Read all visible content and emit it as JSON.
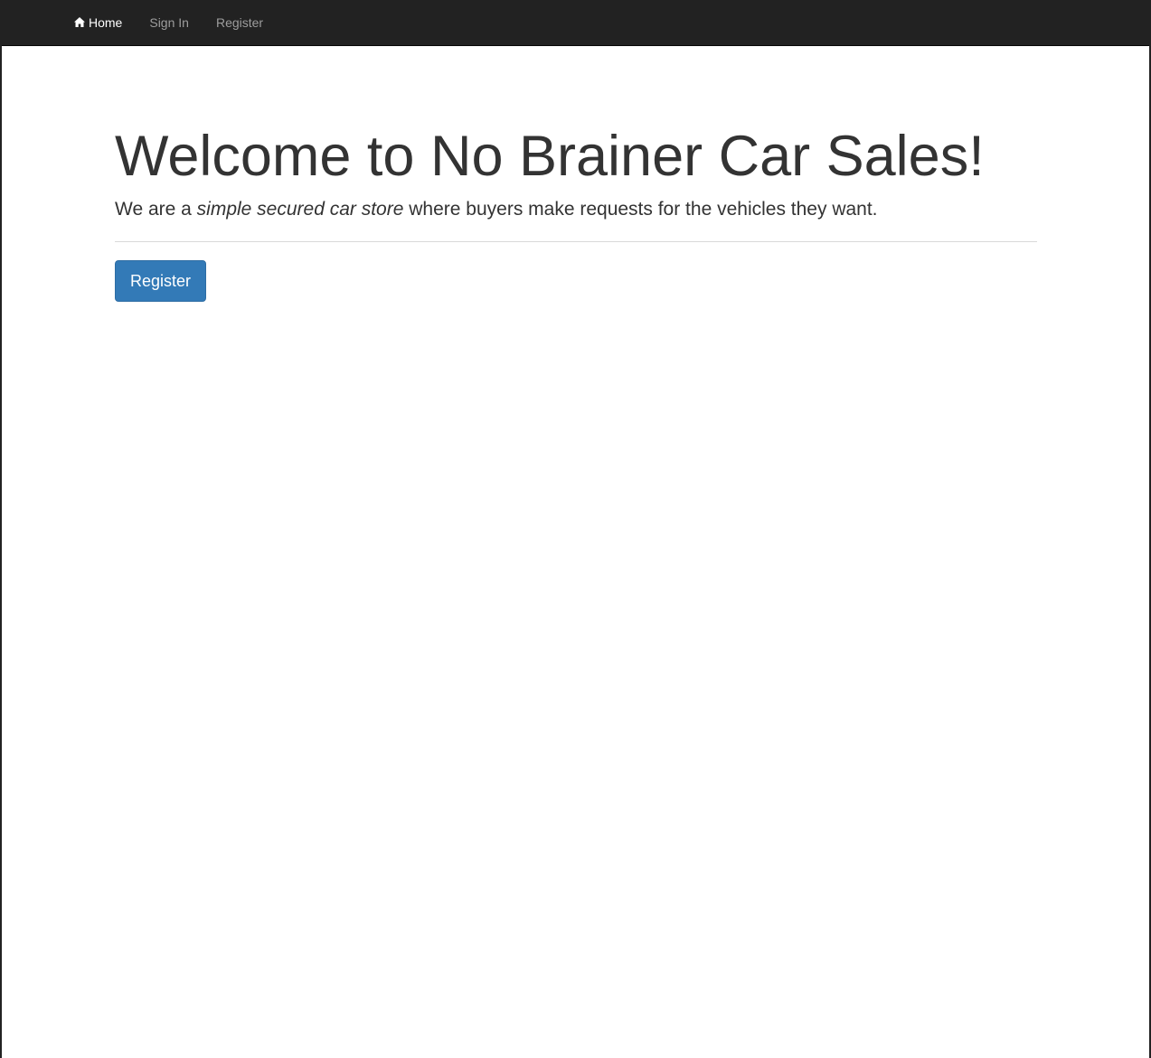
{
  "navbar": {
    "items": [
      {
        "label": "Home",
        "icon": "home-icon",
        "active": true
      },
      {
        "label": "Sign In",
        "active": false
      },
      {
        "label": "Register",
        "active": false
      }
    ]
  },
  "jumbotron": {
    "title": "Welcome to No Brainer Car Sales!",
    "lead_prefix": "We are a ",
    "lead_emphasis": "simple secured car store",
    "lead_suffix": " where buyers make requests for the vehicles they want.",
    "button_label": "Register"
  },
  "colors": {
    "navbar_bg": "#222222",
    "nav_text": "#9d9d9d",
    "nav_active_text": "#ffffff",
    "primary_button": "#337ab7",
    "body_text": "#333333"
  }
}
